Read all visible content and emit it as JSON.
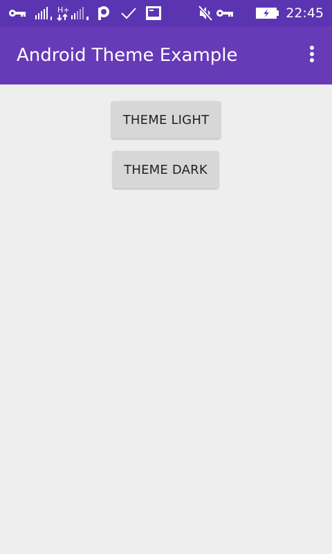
{
  "status_bar": {
    "time": "22:45",
    "icons": [
      "vpn-key-icon",
      "signal-sim1-icon",
      "hplus-data-icon",
      "signal-sim2-icon",
      "p-app-icon",
      "check-icon",
      "screen-icon",
      "mute-icon",
      "vpn-key-icon",
      "battery-charging-icon"
    ]
  },
  "app_bar": {
    "title": "Android Theme Example",
    "menu_icon": "overflow-menu-icon"
  },
  "buttons": {
    "theme_light": "THEME LIGHT",
    "theme_dark": "THEME DARK"
  },
  "colors": {
    "status_bar": "#5b35b1",
    "app_bar": "#673ab7",
    "background": "#eeeeee",
    "button": "#d7d7d7"
  }
}
